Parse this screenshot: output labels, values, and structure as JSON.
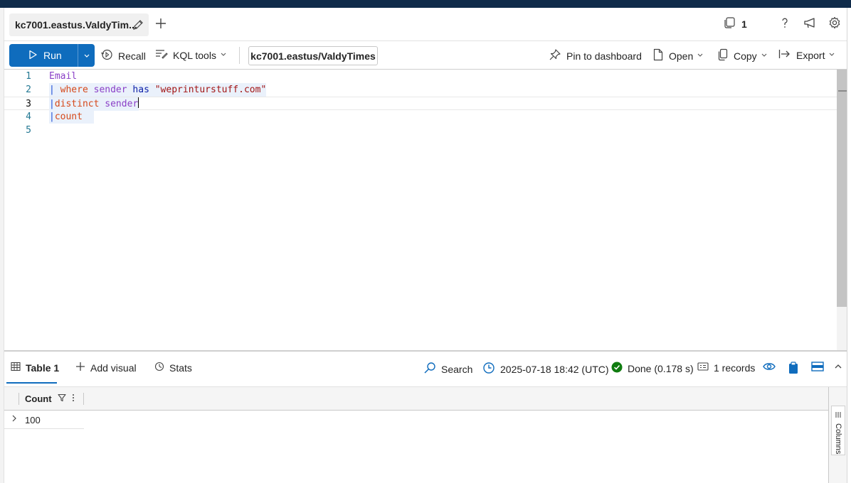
{
  "tab": {
    "title": "kc7001.eastus.ValdyTim..."
  },
  "header": {
    "connection_count": "1"
  },
  "toolbar": {
    "run_label": "Run",
    "recall_label": "Recall",
    "kql_tools_label": "KQL tools",
    "database": "kc7001.eastus/ValdyTimes",
    "pin_label": "Pin to dashboard",
    "open_label": "Open",
    "copy_label": "Copy",
    "export_label": "Export"
  },
  "editor": {
    "lines": [
      {
        "number": "1",
        "tokens": [
          "Email"
        ]
      },
      {
        "number": "2",
        "tokens": [
          "| ",
          "where",
          " ",
          "sender",
          " ",
          "has",
          " ",
          "\"weprinturstuff.com\""
        ]
      },
      {
        "number": "3",
        "tokens": [
          "|",
          "distinct",
          " ",
          "sender"
        ]
      },
      {
        "number": "4",
        "tokens": [
          "|",
          "count"
        ]
      },
      {
        "number": "5",
        "tokens": []
      }
    ]
  },
  "results": {
    "table_tab": "Table 1",
    "add_visual": "Add visual",
    "stats": "Stats",
    "search": "Search",
    "timestamp": "2025-07-18 18:42 (UTC)",
    "status": "Done (0.178 s)",
    "records": "1 records",
    "columns": [
      "Count"
    ],
    "rows": [
      [
        "100"
      ]
    ],
    "side_panel_label": "Columns"
  },
  "colors": {
    "accent": "#0f6cbd",
    "status_done": "#107c10",
    "kql_table": "#8a3fc7",
    "kql_operator": "#d6491a",
    "kql_keyword": "#0b1ea8",
    "kql_string": "#a31515",
    "line_number": "#237893"
  },
  "icons": {
    "tab": "pencil-icon",
    "new_tab": "plus-icon",
    "connections": "copy-stack-icon",
    "help": "question-icon",
    "feedback": "megaphone-icon",
    "settings": "gear-icon",
    "run": "play-icon",
    "recall": "history-icon",
    "kql_tools": "format-icon",
    "pin": "pin-icon",
    "open": "document-icon",
    "copy": "copy-icon",
    "export": "export-icon",
    "table": "table-icon",
    "add_visual": "plus-icon",
    "stats": "stats-icon",
    "search": "search-icon",
    "time": "clock-icon",
    "done": "checkmark-circle-icon",
    "records": "records-icon",
    "view": "eye-icon",
    "clipboard": "clipboard-icon",
    "layout": "layout-icon",
    "collapse": "chevron-up-icon",
    "filter": "filter-icon",
    "more": "more-vertical-icon",
    "expand_row": "chevron-right-icon",
    "columns": "columns-icon"
  }
}
